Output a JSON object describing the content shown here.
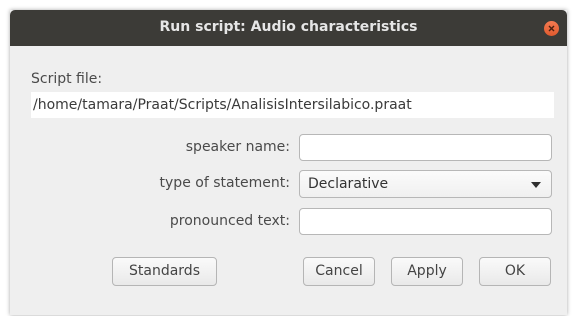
{
  "window": {
    "title": "Run script: Audio characteristics"
  },
  "script_file": {
    "label": "Script file:",
    "path": "/home/tamara/Praat/Scripts/AnalisisIntersilabico.praat"
  },
  "form": {
    "speaker_name": {
      "label": "speaker name:",
      "value": ""
    },
    "type_of_statement": {
      "label": "type of statement:",
      "selected": "Declarative"
    },
    "pronounced_text": {
      "label": "pronounced text:",
      "value": ""
    }
  },
  "buttons": {
    "standards": "Standards",
    "cancel": "Cancel",
    "apply": "Apply",
    "ok": "OK"
  },
  "colors": {
    "titlebar": "#3c3b37",
    "close": "#e8633a",
    "dialog_bg": "#efefef"
  }
}
